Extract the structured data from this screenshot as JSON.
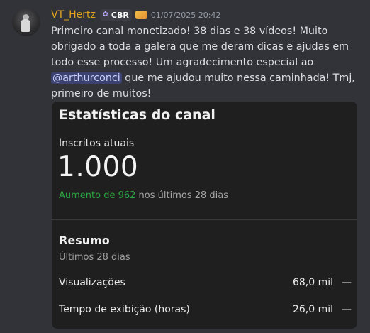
{
  "message": {
    "author": "VT_Hertz",
    "tag": {
      "icon": "clan-badge-icon",
      "label": "CBR"
    },
    "role_icon": "badge-icon",
    "timestamp": "01/07/2025 20:42",
    "text_before_mention": "Primeiro canal monetizado! 38 dias e 38 vídeos! Muito obrigado a toda a galera que me deram dicas e ajudas em todo esse processo! Um agradecimento especial ao ",
    "mention": "@arthurconci",
    "text_after_mention": " que me ajudou muito nessa caminhada! Tmj, primeiro de muitos!"
  },
  "embed": {
    "title": "Estatísticas do canal",
    "subscribers_label": "Inscritos atuais",
    "subscribers_value": "1.000",
    "increase_prefix": "Aumento de 962",
    "increase_suffix": " nos últimos 28 dias",
    "summary_title": "Resumo",
    "summary_subtitle": "Últimos 28 dias",
    "metrics": [
      {
        "label": "Visualizações",
        "value": "68,0 mil",
        "trend": "—"
      },
      {
        "label": "Tempo de exibição (horas)",
        "value": "26,0 mil",
        "trend": "—"
      }
    ]
  },
  "colors": {
    "background": "#323339",
    "username": "#e0a61e",
    "embed_background": "#1f1f1f",
    "increase_green": "#2ba640",
    "mention_background": "#3c4270"
  }
}
